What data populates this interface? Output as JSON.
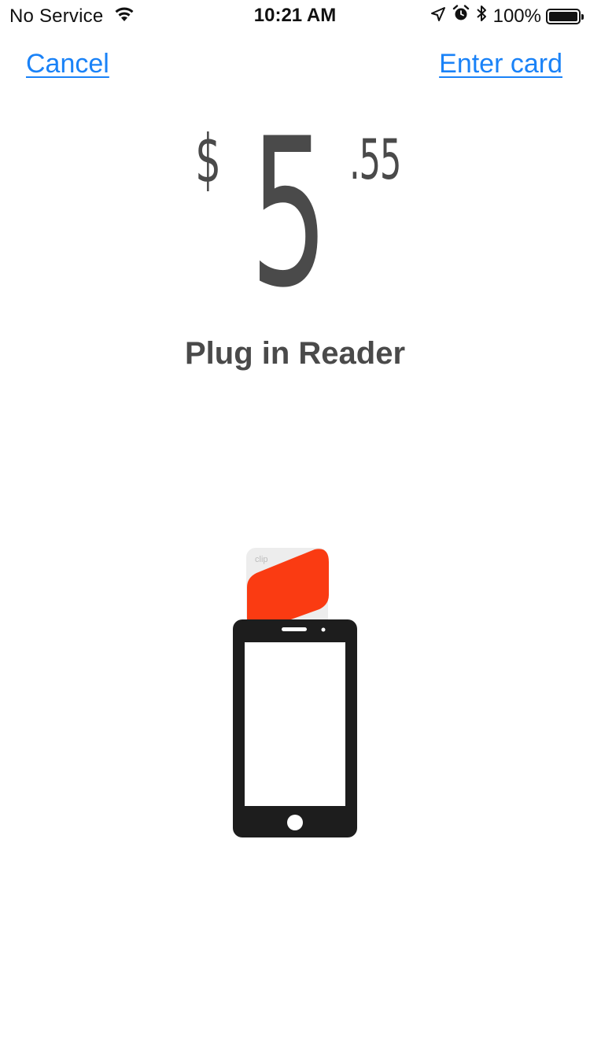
{
  "status_bar": {
    "carrier": "No Service",
    "time": "10:21 AM",
    "battery": "100%",
    "battery_level": 1.0,
    "icons": [
      "wifi-icon",
      "location-icon",
      "alarm-icon",
      "bluetooth-icon",
      "battery-icon"
    ]
  },
  "nav": {
    "cancel_label": "Cancel",
    "enter_card_label": "Enter card"
  },
  "amount": {
    "currency": "$",
    "whole": "5",
    "cents": ".55"
  },
  "instruction": "Plug in Reader",
  "reader": {
    "brand": "clip"
  },
  "colors": {
    "link": "#1a82f7",
    "text": "#4a4a4a",
    "reader_accent": "#fa3b12",
    "phone": "#1d1d1d"
  }
}
